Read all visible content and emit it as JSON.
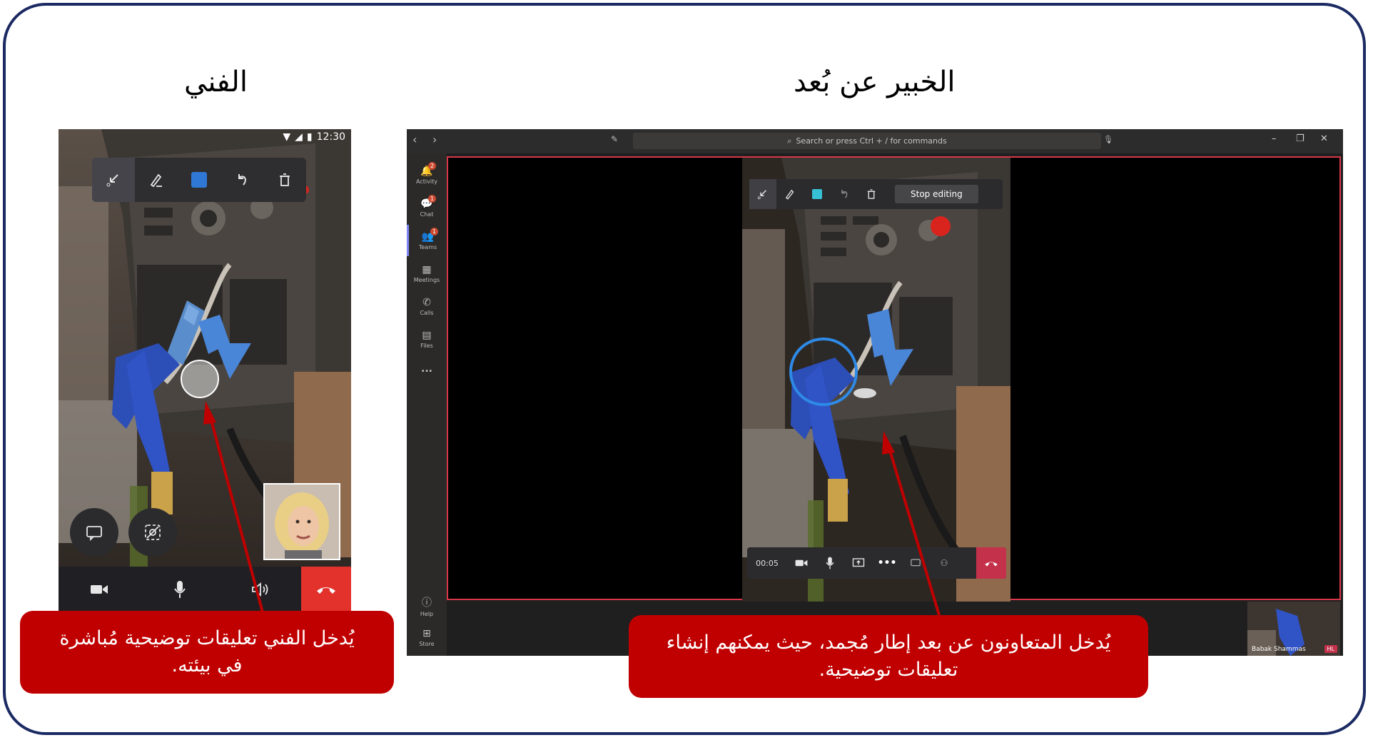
{
  "titles": {
    "technician": "الفني",
    "remote_expert": "الخبير عن بُعد"
  },
  "phone": {
    "status_time": "12:30",
    "ink_tools": [
      "pointer-icon",
      "pen-icon",
      "color-icon",
      "undo-icon",
      "trash-icon"
    ],
    "controls": [
      "chat-icon",
      "hide-view-icon"
    ],
    "bottom_bar": [
      "video-icon",
      "mic-icon",
      "speaker-icon",
      "hang-up-icon"
    ]
  },
  "teams": {
    "search_placeholder": "Search or press Ctrl + / for commands",
    "rail": [
      {
        "label": "Activity",
        "badge": "2"
      },
      {
        "label": "Chat",
        "badge": "1"
      },
      {
        "label": "Teams",
        "badge": "1"
      },
      {
        "label": "Meetings",
        "badge": ""
      },
      {
        "label": "Calls",
        "badge": ""
      },
      {
        "label": "Files",
        "badge": ""
      },
      {
        "label": "...",
        "badge": ""
      }
    ],
    "rail_bottom": [
      {
        "label": "Help"
      },
      {
        "label": "Store"
      }
    ],
    "stop_editing": "Stop editing",
    "call_timer": "00:05",
    "self_name": "Babak Shammas",
    "self_tag": "HL",
    "accent": "#c4314b",
    "stage_border": "#d7374a"
  },
  "callouts": {
    "technician": "يُدخل الفني تعليقات توضيحية مُباشرة\nفي بيئته.",
    "remote": "يُدخل المتعاونون عن بعد إطار مُجمد، حيث يمكنهم إنشاء\nتعليقات توضيحية."
  },
  "colors": {
    "frame_border": "#1b2a63",
    "callout_bg": "#c00000",
    "arrow": "#c00000",
    "annotation_arrow": "#4a86d8"
  }
}
